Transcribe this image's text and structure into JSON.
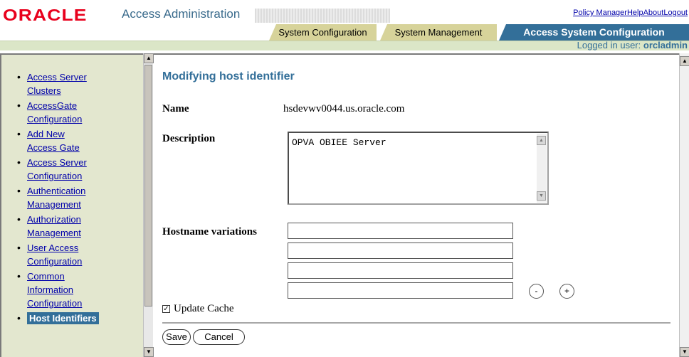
{
  "header": {
    "logo_text": "ORACLE",
    "app_title": "Access Administration",
    "links": [
      "Policy Manager",
      "Help",
      "About",
      "Logout"
    ],
    "tabs": [
      {
        "label": "System Configuration"
      },
      {
        "label": "System Management"
      },
      {
        "label": "Access System Configuration",
        "active": true
      }
    ],
    "login_prefix": "Logged in user:",
    "login_user": "orcladmin"
  },
  "nav": {
    "items": [
      {
        "line1": "Access Server",
        "line2": "Clusters"
      },
      {
        "line1": "AccessGate",
        "line2": "Configuration"
      },
      {
        "line1": "Add New",
        "line2": "Access Gate"
      },
      {
        "line1": "Access Server",
        "line2": "Configuration"
      },
      {
        "line1": "Authentication",
        "line2": "Management"
      },
      {
        "line1": "Authorization",
        "line2": "Management"
      },
      {
        "line1": "User Access",
        "line2": "Configuration"
      },
      {
        "line1": "Common",
        "line2": "Information",
        "line3": "Configuration"
      },
      {
        "line1": "Host Identifiers",
        "active": true
      }
    ]
  },
  "main": {
    "title": "Modifying host identifier",
    "name_label": "Name",
    "name_value": "hsdevwv0044.us.oracle.com",
    "description_label": "Description",
    "description_value": "OPVA OBIEE Server",
    "hostname_label": "Hostname variations",
    "hostname_values": [
      "",
      "",
      "",
      ""
    ],
    "minus_label": "-",
    "plus_label": "+",
    "update_cache_label": "Update Cache",
    "update_cache_checked": true,
    "save_label": "Save",
    "cancel_label": "Cancel"
  },
  "colors": {
    "oracle_red": "#e8001c",
    "accent_blue": "#336f99",
    "tab_khaki": "#d7d39a",
    "nav_background": "#e3e7cf"
  }
}
